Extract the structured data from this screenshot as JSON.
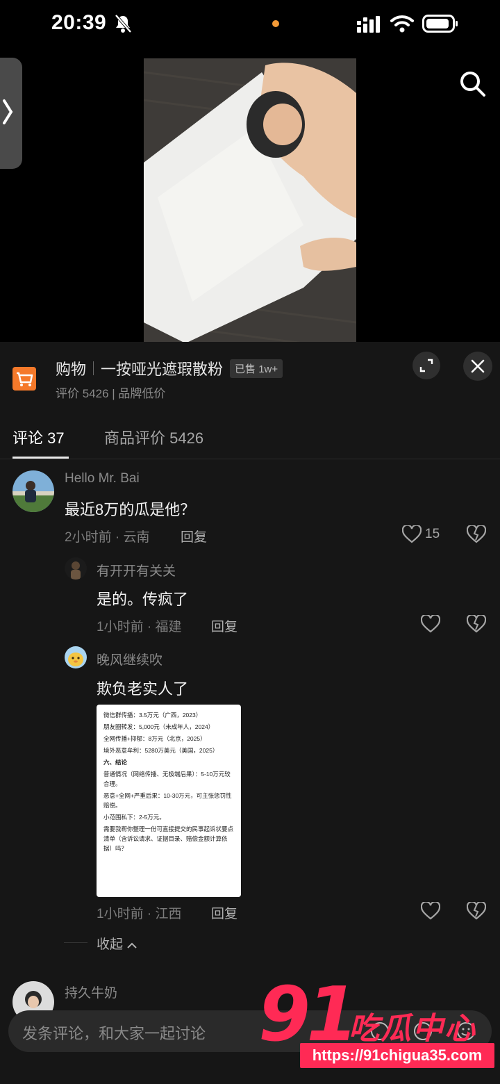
{
  "status_bar": {
    "time": "20:39"
  },
  "product": {
    "category": "购物",
    "title": "一按哑光遮瑕散粉",
    "sold_badge": "已售 1w+",
    "subtitle": "评价 5426 | 品牌低价"
  },
  "tabs": [
    {
      "label": "评论 37",
      "active": true
    },
    {
      "label": "商品评价 5426",
      "active": false
    }
  ],
  "comments": [
    {
      "user": "Hello Mr. Bai",
      "text": "最近8万的瓜是他？",
      "meta": "2小时前 · 云南",
      "reply_label": "回复",
      "like_count": "15"
    },
    {
      "user": "有开开有关关",
      "text": "是的。传疯了",
      "meta": "1小时前 · 福建",
      "reply_label": "回复"
    },
    {
      "user": "晚风继续吹",
      "text": "欺负老实人了",
      "meta": "1小时前 · 江西",
      "reply_label": "回复",
      "image_lines": [
        "微信群传播：3.5万元（广西，2023）",
        "朋友圈转发：5,000元（未成年人，2024）",
        "全网传播+抑郁：8万元（北京，2025）",
        "境外恶意牟利：5280万美元（美国，2025）",
        "六、结论",
        "普通情况（网络传播、无极端后果）：5-10万元较合理。",
        "恶意+全网+严重后果：10-30万元，可主张惩罚性赔偿。",
        "小范围私下：2-5万元。",
        "需要我帮你整理一份可直接提交的民事起诉状要点清单（含诉讼请求、证据目录、赔偿金额计算依据）吗？"
      ]
    },
    {
      "user": "持久牛奶"
    }
  ],
  "collapse_label": "收起",
  "input_placeholder": "发条评论，和大家一起讨论",
  "watermark": {
    "number": "91",
    "text": "吃瓜中心",
    "url": "https://91chigua35.com"
  },
  "colors": {
    "accent_orange": "#f5792a",
    "watermark_red": "#ff2a55",
    "sheet_bg": "#161616"
  }
}
